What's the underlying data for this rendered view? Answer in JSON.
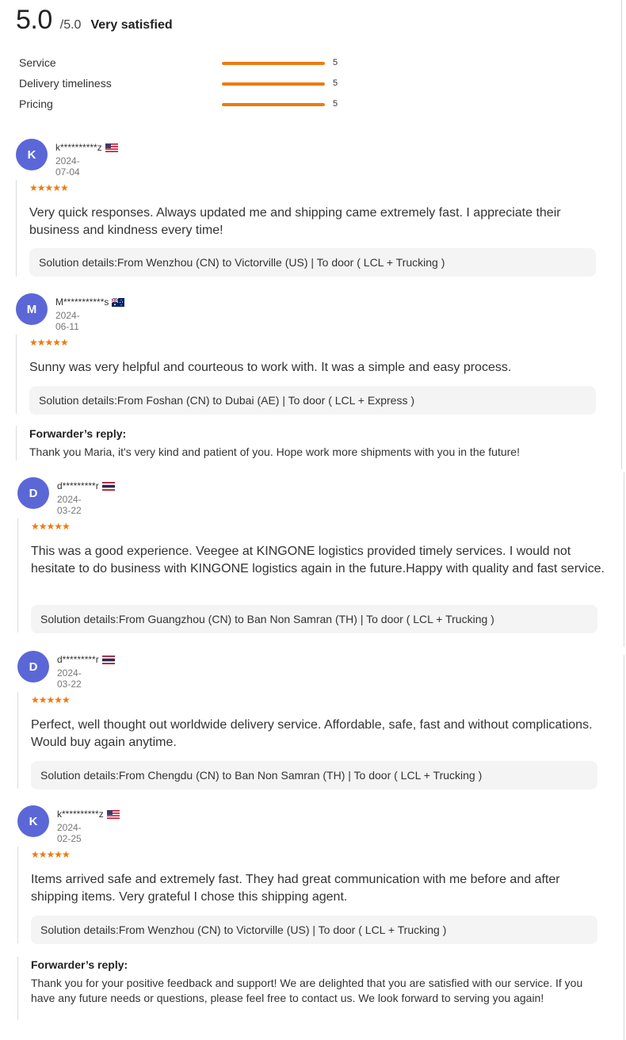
{
  "summary": {
    "score": "5.0",
    "max": "/5.0",
    "verdict": "Very satisfied",
    "metrics": [
      {
        "label": "Service",
        "value": "5",
        "fraction": 1.0
      },
      {
        "label": "Delivery timeliness",
        "value": "5",
        "fraction": 1.0
      },
      {
        "label": "Pricing",
        "value": "5",
        "fraction": 1.0
      }
    ]
  },
  "colors": {
    "accent": "#ee7a11",
    "avatar": "#5b67d6",
    "solution_bg": "#f4f4f4"
  },
  "reviews": [
    {
      "initial": "K",
      "user": "k**********z",
      "flag": "us-flag-icon",
      "date": "2024-07-04",
      "stars": "★★★★★",
      "text": "Very quick responses. Always updated me and shipping came extremely fast. I appreciate their business and kindness every time!",
      "solution": "Solution details:From Wenzhou (CN) to Victorville (US)  | To door ( LCL + Trucking )"
    },
    {
      "initial": "M",
      "user": "M***********s",
      "flag": "au-flag-icon",
      "date": "2024-06-11",
      "stars": "★★★★★",
      "text": "Sunny was very helpful and courteous to work with. It was a simple and easy process.",
      "solution": "Solution details:From Foshan (CN) to Dubai (AE)  | To door ( LCL + Express )",
      "reply_title": "Forwarder’s reply:",
      "reply": "Thank you Maria, it's very kind and patient of you. Hope work more shipments with you in the future!"
    },
    {
      "initial": "D",
      "user": "d*********r",
      "flag": "th-flag-icon",
      "date": "2024-03-22",
      "stars": "★★★★★",
      "text": "This was a good experience. Veegee at KINGONE logistics provided timely services. I would not hesitate to do business with KINGONE logistics again in the future.Happy with quality and fast service.",
      "solution": "Solution details:From Guangzhou (CN) to Ban Non Samran (TH)  | To door ( LCL + Trucking )"
    },
    {
      "initial": "D",
      "user": "d*********r",
      "flag": "th-flag-icon",
      "date": "2024-03-22",
      "stars": "★★★★★",
      "text": "Perfect, well thought out worldwide delivery service. Affordable, safe, fast and without complications. Would buy again anytime.",
      "solution": "Solution details:From Chengdu (CN) to Ban Non Samran (TH)  | To door ( LCL + Trucking )"
    },
    {
      "initial": "K",
      "user": "k**********z",
      "flag": "us-flag-icon",
      "date": "2024-02-25",
      "stars": "★★★★★",
      "text": "Items arrived safe and extremely fast. They had great communication with me before and after shipping items. Very grateful I chose this shipping agent.",
      "solution": "Solution details:From Wenzhou (CN) to Victorville (US)  | To door ( LCL + Trucking )",
      "reply_title": "Forwarder’s reply:",
      "reply": "Thank you for your positive feedback and support! We are delighted that you are satisfied with our service. If you have any future needs or questions, please feel free to contact us. We look forward to serving you again!"
    }
  ]
}
